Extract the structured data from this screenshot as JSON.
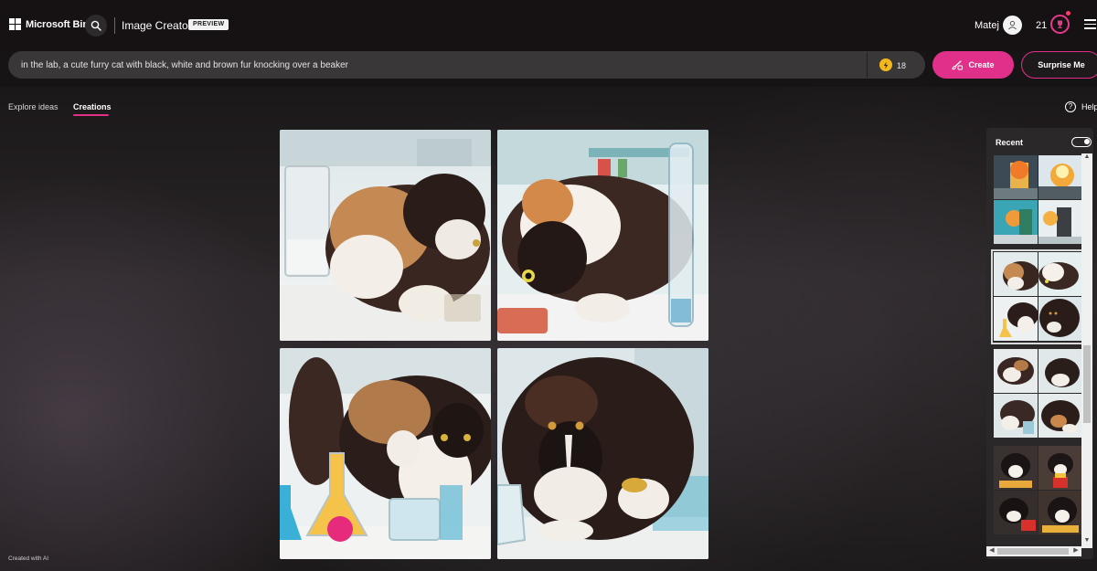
{
  "header": {
    "brand": "Microsoft Bing",
    "product": "Image Creator",
    "badge": "PREVIEW",
    "user_name": "Matej",
    "rewards_points": "21"
  },
  "prompt": {
    "value": "in the lab, a cute furry cat with black, white and brown fur knocking over a beaker",
    "boosts": "18",
    "create_label": "Create",
    "surprise_label": "Surprise Me"
  },
  "tabs": [
    {
      "label": "Explore ideas",
      "active": false
    },
    {
      "label": "Creations",
      "active": true
    }
  ],
  "help_label": "Help",
  "footer_note": "Created with AI",
  "recent": {
    "title": "Recent",
    "toggle_on": true,
    "groups": [
      {
        "theme": "lab-fire",
        "selected": false
      },
      {
        "theme": "calico-cat-lab",
        "selected": true
      },
      {
        "theme": "calico-cat-lab",
        "selected": false
      },
      {
        "theme": "cat-fries",
        "selected": false
      }
    ]
  },
  "images": [
    {
      "alt": "calico cat sniffing lab glassware"
    },
    {
      "alt": "calico cat drinking from red beaker"
    },
    {
      "alt": "calico cat with colorful flasks"
    },
    {
      "alt": "black and white cat knocking over beaker"
    }
  ],
  "colors": {
    "accent": "#e1308a",
    "boost": "#f4b81f",
    "bar": "#3a3738"
  }
}
